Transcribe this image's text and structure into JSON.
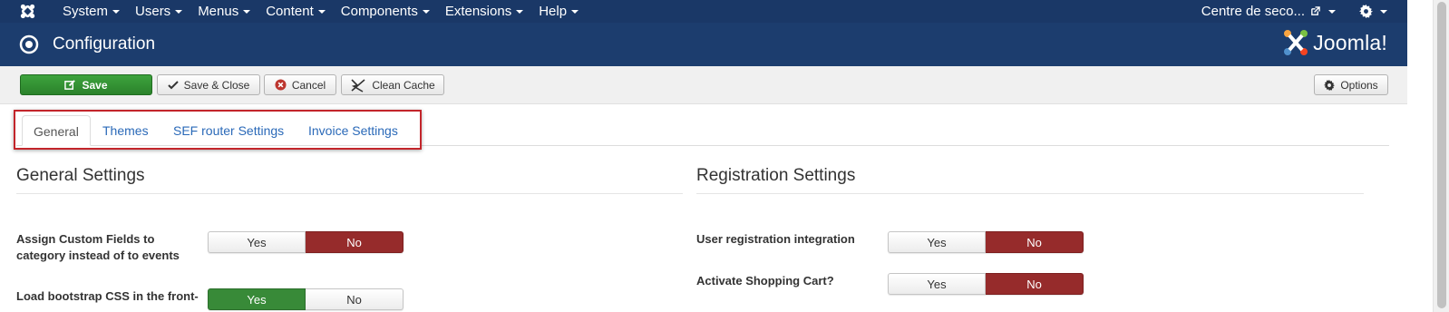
{
  "navbar": {
    "menus": [
      "System",
      "Users",
      "Menus",
      "Content",
      "Components",
      "Extensions",
      "Help"
    ],
    "site_link": "Centre de seco..."
  },
  "header": {
    "title": "Configuration",
    "brand": "Joomla!"
  },
  "toolbar": {
    "save": "Save",
    "save_close": "Save & Close",
    "cancel": "Cancel",
    "clean_cache": "Clean Cache",
    "options": "Options"
  },
  "tabs": [
    "General",
    "Themes",
    "SEF router Settings",
    "Invoice Settings"
  ],
  "active_tab": "General",
  "general": {
    "title": "General Settings",
    "fields": [
      {
        "label": "Assign Custom Fields to category instead of to events",
        "yes": "Yes",
        "no": "No",
        "value": "No"
      },
      {
        "label": "Load bootstrap CSS in the front-",
        "yes": "Yes",
        "no": "No",
        "value": "Yes"
      }
    ]
  },
  "registration": {
    "title": "Registration Settings",
    "fields": [
      {
        "label": "User registration integration",
        "yes": "Yes",
        "no": "No",
        "value": "No"
      },
      {
        "label": "Activate Shopping Cart?",
        "yes": "Yes",
        "no": "No",
        "value": "No"
      }
    ]
  },
  "colors": {
    "navbar": "#1a3867",
    "header": "#1c3d6e",
    "save_green": "#2f8f2f",
    "toggle_no_red": "#962b2b",
    "toggle_yes_green": "#388a38",
    "link_blue": "#2a69b8",
    "highlight_red": "#c3252b"
  }
}
